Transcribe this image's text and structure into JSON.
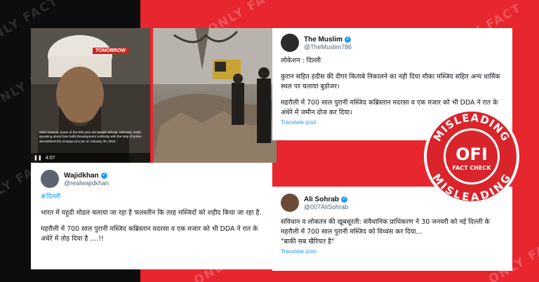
{
  "watermark": {
    "text": "ONLY FACT"
  },
  "video": {
    "channel_logo": "TOMORROW",
    "caption": "Zakir hussain, Imam of the 600 year old Masjid Akhonji, Mehrauli, Delhi, speaking about how Delhi Development Authority with the help of police demolished the mosque at 6 am on January 30, 2024.",
    "time": "4:07"
  },
  "tweets": {
    "muslim": {
      "name": "The Muslim",
      "handle": "@TheMuslim786",
      "line1": "लोकेशन : दिल्ली",
      "line2": "कुरान सहित हदीस की दीगर किताबे निकालने का नही दिया मौका मस्जिद सहित अन्य धार्मिक स्थल पर चलाया बुडोजर।",
      "line3": "महरौली में 700 साल पुरानी मस्जिद कब्रिस्तान मदरसा व एक मजार को भी DDA ने रात के अंधेरे में जमीन दोज कर दिया।",
      "translate": "Translate post"
    },
    "wajid": {
      "name": "Wajidkhan",
      "handle": "@realwajidkhan",
      "hashtag": "#दिल्ली",
      "line1": "भारत में यहुदी मोडल चलाया जा रहा है फलस्तीन कि तरह मस्जिदों को शहीद किया जा रहा है.",
      "line2": "महरौली में 700 साल पुरानी मस्जिद कब्रिस्तान मदरसा व एक मजार को भी DDA ने रात के अंधेरे में तोड़ दिया है ....!!"
    },
    "ali": {
      "name": "Ali Sohrab",
      "handle": "@007AliSohrab",
      "line1": "संविधान व लोकतंत्र की खूबसूरती: संवैधानिक प्राधिकरण ने 30 जनवरी को नई दिल्ली के महरौली में 700 साल पुरानी मस्जिद को विध्वंस कर दिया...",
      "line2": "\"बाकी सब खैरियत है\"",
      "translate": "Translate post"
    }
  },
  "stamp": {
    "top": "MISLEADING",
    "logo": "OFI",
    "sub": "FACT CHECK",
    "bottom": "MISLEADING"
  },
  "colors": {
    "red": "#e8262f",
    "verified": "#1d9bf0"
  }
}
